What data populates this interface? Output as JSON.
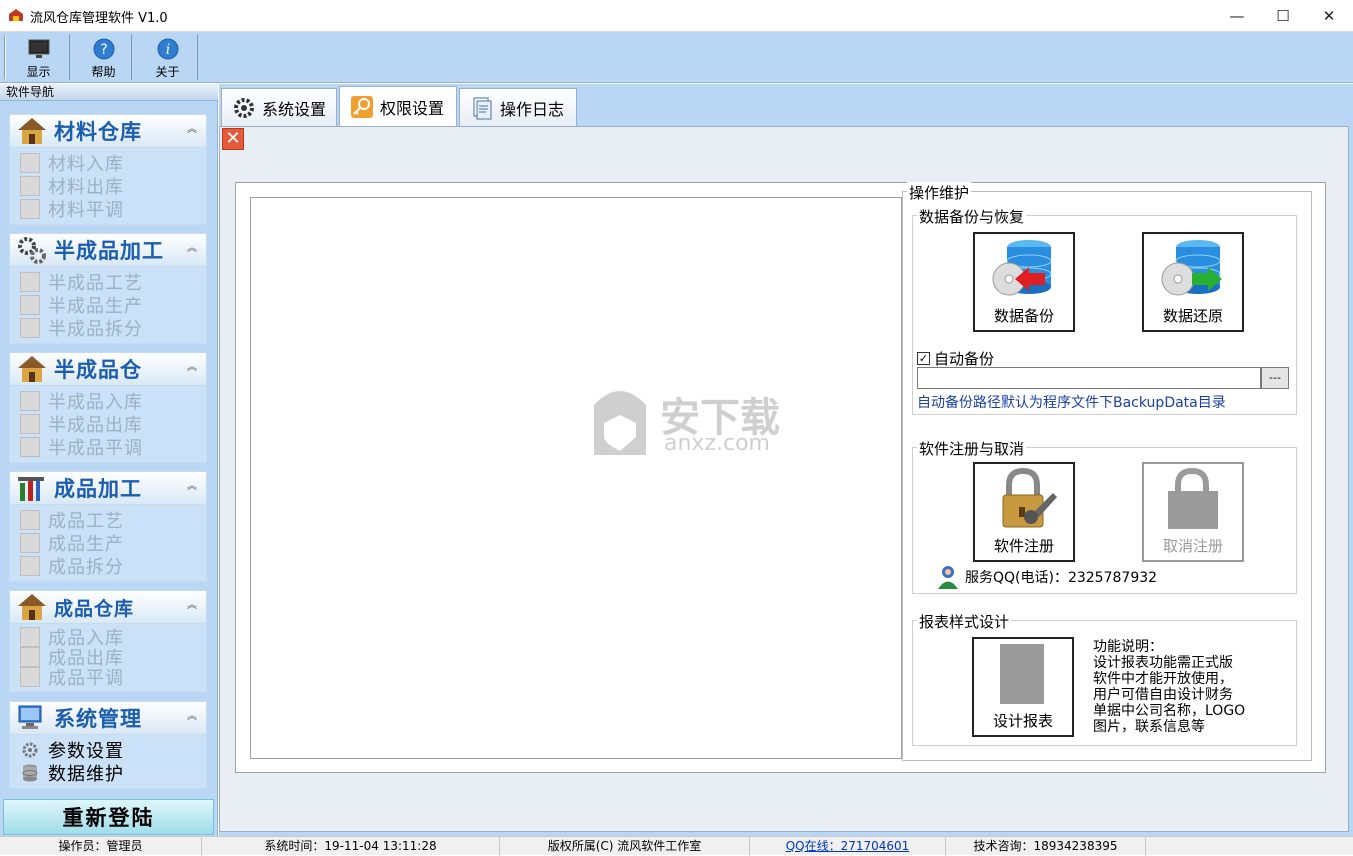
{
  "window": {
    "title": "流风仓库管理软件 V1.0",
    "minimize": "—",
    "maximize": "☐",
    "close": "✕"
  },
  "toolbar": {
    "items": [
      {
        "label": "显示"
      },
      {
        "label": "帮助"
      },
      {
        "label": "关于"
      }
    ]
  },
  "sidebar": {
    "header": "软件导航",
    "groups": [
      {
        "title": "材料仓库",
        "items": [
          "材料入库",
          "材料出库",
          "材料平调"
        ]
      },
      {
        "title": "半成品加工",
        "items": [
          "半成品工艺",
          "半成品生产",
          "半成品拆分"
        ]
      },
      {
        "title": "半成品仓",
        "items": [
          "半成品入库",
          "半成品出库",
          "半成品平调"
        ]
      },
      {
        "title": "成品加工",
        "items": [
          "成品工艺",
          "成品生产",
          "成品拆分"
        ]
      },
      {
        "title": "成品仓库",
        "items": [
          "成品入库",
          "成品出库",
          "成品平调"
        ]
      },
      {
        "title": "系统管理",
        "items": [
          "参数设置",
          "数据维护"
        ]
      }
    ],
    "relogin": "重新登陆"
  },
  "tabs": [
    {
      "label": "系统设置"
    },
    {
      "label": "权限设置"
    },
    {
      "label": "操作日志"
    }
  ],
  "maintenance": {
    "title": "操作维护",
    "backup_section": "数据备份与恢复",
    "backup_button": "数据备份",
    "restore_button": "数据还原",
    "auto_backup_label": "自动备份",
    "auto_backup_checked": true,
    "path_value": "",
    "browse_button": "---",
    "path_hint": "自动备份路径默认为程序文件下BackupData目录",
    "register_section": "软件注册与取消",
    "register_button": "软件注册",
    "unregister_button": "取消注册",
    "service_qq": "服务QQ(电话)：2325787932",
    "report_section": "报表样式设计",
    "design_button": "设计报表",
    "desc_lines": [
      "功能说明：",
      "设计报表功能需正式版",
      "软件中才能开放使用，",
      "用户可借自由设计财务",
      "单据中公司名称，LOGO",
      "图片，联系信息等"
    ]
  },
  "watermark": {
    "main": "安下载",
    "sub": "anxz.com"
  },
  "status": {
    "operator": "操作员：管理员",
    "time": "系统时间：19-11-04 13:11:28",
    "copyright": "版权所属(C) 流风软件工作室",
    "qq": "QQ在线：271704601",
    "support": "技术咨询：18934238395"
  }
}
